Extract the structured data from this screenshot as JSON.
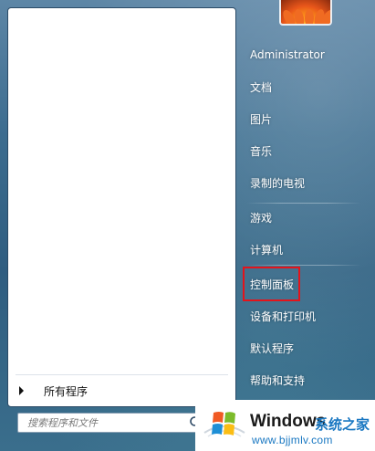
{
  "left_pane": {
    "all_programs_label": "所有程序",
    "search_placeholder": "搜索程序和文件"
  },
  "right_pane": {
    "user_name": "Administrator",
    "items": [
      {
        "label": "文档"
      },
      {
        "label": "图片"
      },
      {
        "label": "音乐"
      },
      {
        "label": "录制的电视"
      },
      {
        "label": "游戏"
      },
      {
        "label": "计算机"
      },
      {
        "label": "控制面板",
        "highlighted": true
      },
      {
        "label": "设备和打印机"
      },
      {
        "label": "默认程序"
      },
      {
        "label": "帮助和支持"
      }
    ]
  },
  "icons": {
    "avatar": "flower-avatar-icon",
    "search": "search-icon",
    "all_programs": "triangle-right-icon",
    "watermark_logo": "windows-logo-icon"
  },
  "watermark": {
    "brand": "Windows",
    "suffix": "系统之家",
    "url": "www.bjjmlv.com"
  },
  "colors": {
    "highlight_border": "#e3141b",
    "watermark_blue": "#1a78c2"
  }
}
